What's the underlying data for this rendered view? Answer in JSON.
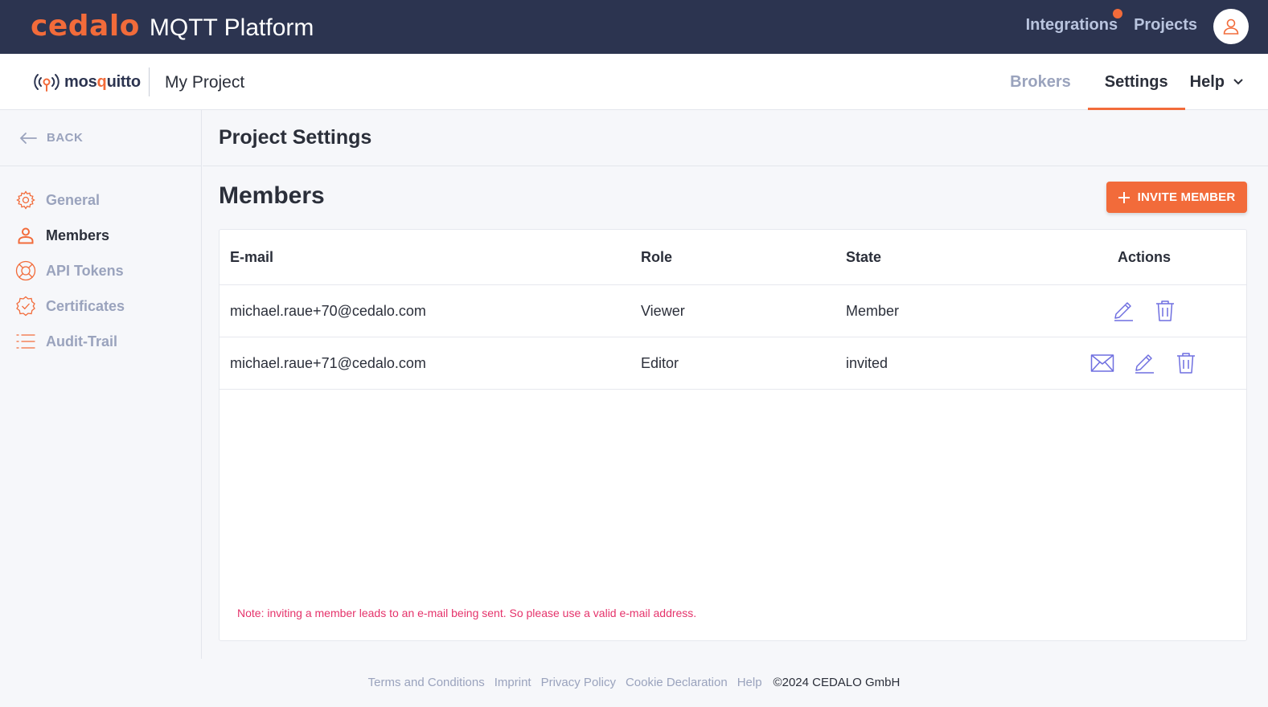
{
  "topbar": {
    "brand": "cedalo",
    "product": "MQTT Platform",
    "nav": [
      {
        "label": "Integrations",
        "has_notification": true
      },
      {
        "label": "Projects",
        "has_notification": false
      }
    ],
    "avatar_icon": "user-icon",
    "accent_color": "#f26b3a",
    "background_color": "#2c3450"
  },
  "subbar": {
    "logo_text_pre": "mos",
    "logo_text_q": "q",
    "logo_text_post": "uitto",
    "project_name": "My Project",
    "tabs": [
      {
        "label": "Brokers",
        "active": false
      },
      {
        "label": "Settings",
        "active": true
      },
      {
        "label": "Help",
        "active": false,
        "dropdown": true
      }
    ]
  },
  "sidebar": {
    "back_label": "BACK",
    "items": [
      {
        "label": "General",
        "icon": "gear-icon",
        "active": false
      },
      {
        "label": "Members",
        "icon": "user-icon",
        "active": true
      },
      {
        "label": "API Tokens",
        "icon": "lifebuoy-icon",
        "active": false
      },
      {
        "label": "Certificates",
        "icon": "certificate-icon",
        "active": false
      },
      {
        "label": "Audit-Trail",
        "icon": "list-icon",
        "active": false
      }
    ]
  },
  "main": {
    "page_title": "Project Settings",
    "section_title": "Members",
    "invite_button_label": "INVITE MEMBER",
    "table": {
      "columns": [
        "E-mail",
        "Role",
        "State",
        "Actions"
      ],
      "rows": [
        {
          "email": "michael.raue+70@cedalo.com",
          "role": "Viewer",
          "state": "Member",
          "actions": [
            "edit-icon",
            "trash-icon"
          ]
        },
        {
          "email": "michael.raue+71@cedalo.com",
          "role": "Editor",
          "state": "invited",
          "actions": [
            "mail-icon",
            "edit-icon",
            "trash-icon"
          ]
        }
      ]
    },
    "note": "Note: inviting a member leads to an e-mail being sent. So please use a valid e-mail address."
  },
  "footer": {
    "links": [
      "Terms and Conditions",
      "Imprint",
      "Privacy Policy",
      "Cookie Declaration",
      "Help"
    ],
    "copyright": "©2024 CEDALO GmbH"
  }
}
